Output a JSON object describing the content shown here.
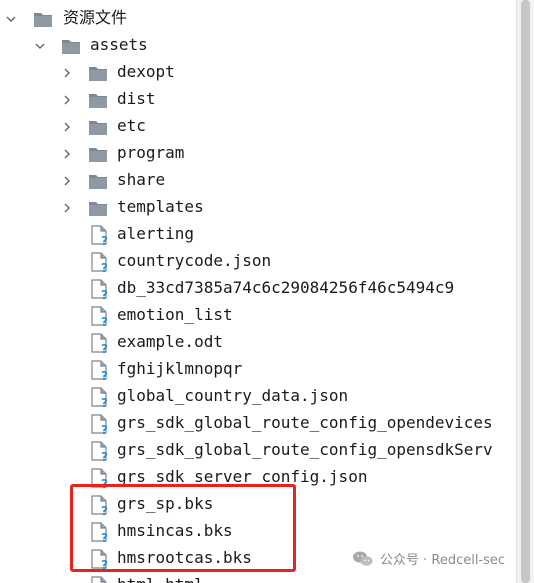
{
  "tree": {
    "root": {
      "label": "资源文件",
      "expanded": true
    },
    "assets": {
      "label": "assets",
      "expanded": true
    },
    "folders": [
      {
        "label": "dexopt"
      },
      {
        "label": "dist"
      },
      {
        "label": "etc"
      },
      {
        "label": "program"
      },
      {
        "label": "share"
      },
      {
        "label": "templates"
      }
    ],
    "files": [
      {
        "label": "alerting"
      },
      {
        "label": "countrycode.json"
      },
      {
        "label": "db_33cd7385a74c6c29084256f46c5494c9"
      },
      {
        "label": "emotion_list"
      },
      {
        "label": "example.odt"
      },
      {
        "label": "fghijklmnopqr"
      },
      {
        "label": "global_country_data.json"
      },
      {
        "label": "grs_sdk_global_route_config_opendevices"
      },
      {
        "label": "grs_sdk_global_route_config_opensdkServ"
      },
      {
        "label": "grs_sdk_server_config.json"
      },
      {
        "label": "grs_sp.bks"
      },
      {
        "label": "hmsincas.bks"
      },
      {
        "label": "hmsrootcas.bks"
      },
      {
        "label": "html.html"
      }
    ]
  },
  "watermark": {
    "text": "公众号 · Redcell-sec"
  },
  "colors": {
    "folder": "#7d8894",
    "file_corner": "#6f7c88",
    "help_badge": "#2b8fd6",
    "highlight": "#e8231f"
  }
}
